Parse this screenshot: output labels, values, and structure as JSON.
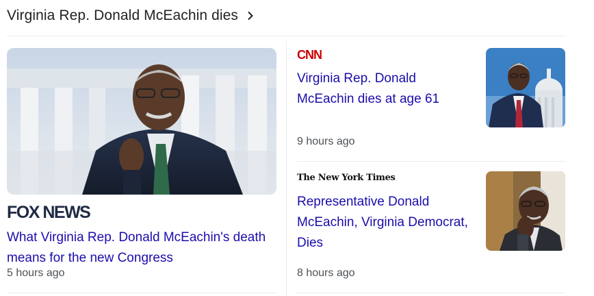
{
  "header": {
    "title": "Virginia Rep. Donald McEachin dies",
    "chevron_icon": "chevron-right-icon"
  },
  "stories": [
    {
      "source": "FOX NEWS",
      "headline": "What Virginia Rep. Donald McEachin's death means for the new Congress",
      "time": "5 hours ago"
    },
    {
      "source": "CNN",
      "headline": "Virginia Rep. Donald McEachin dies at age 61",
      "time": "9 hours ago"
    },
    {
      "source": "The New York Times",
      "headline": "Representative Donald McEachin, Virginia Democrat, Dies",
      "time": "8 hours ago"
    }
  ],
  "colors": {
    "link": "#1a0dab",
    "meta": "#4d5156",
    "cnn_red": "#cc0000",
    "fox_navy": "#1f2a44"
  }
}
